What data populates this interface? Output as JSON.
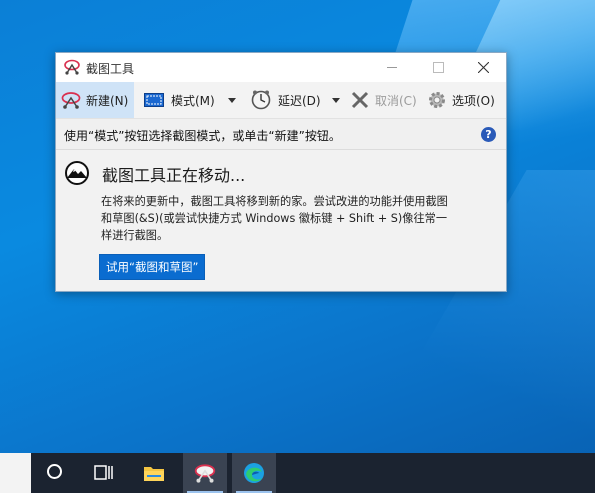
{
  "window": {
    "title": "截图工具",
    "controls": {
      "minimize": "minimize",
      "maximize": "maximize",
      "close": "close"
    }
  },
  "toolbar": {
    "new_label": "新建(N)",
    "mode_label": "模式(M)",
    "delay_label": "延迟(D)",
    "cancel_label": "取消(C)",
    "options_label": "选项(O)"
  },
  "hint": {
    "text": "使用“模式”按钮选择截图模式，或单击“新建”按钮。",
    "help": "?"
  },
  "notice": {
    "heading": "截图工具正在移动...",
    "description": "在将来的更新中，截图工具将移到新的家。尝试改进的功能并使用截图和草图(&S)(或尝试快捷方式 Windows 徽标键 + Shift + S)像往常一样进行截图。",
    "try_button": "试用“截图和草图”"
  },
  "taskbar": {
    "apps": [
      "search-icon",
      "task-view-icon",
      "file-explorer-icon",
      "snipping-tool-icon",
      "edge-icon"
    ]
  },
  "colors": {
    "accent": "#0a6cd0",
    "desktop": "#0b7fd6",
    "taskbar": "#1b2330"
  }
}
